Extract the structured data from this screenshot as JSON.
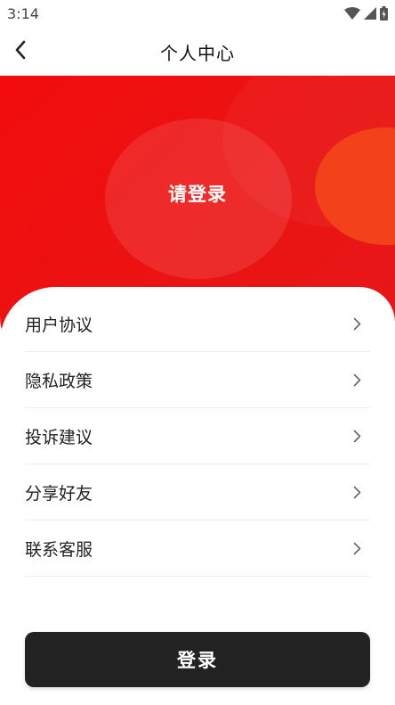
{
  "status_bar": {
    "time": "3:14",
    "icons": [
      "wifi-icon",
      "signal-icon",
      "battery-icon"
    ]
  },
  "nav": {
    "back_icon": "chevron-left-icon",
    "title": "个人中心"
  },
  "hero": {
    "login_prompt": "请登录",
    "color": "#f20c0c",
    "accent_circle_color": "#f3421a"
  },
  "menu": {
    "items": [
      {
        "label": "用户协议",
        "icon": "chevron-right-icon"
      },
      {
        "label": "隐私政策",
        "icon": "chevron-right-icon"
      },
      {
        "label": "投诉建议",
        "icon": "chevron-right-icon"
      },
      {
        "label": "分享好友",
        "icon": "chevron-right-icon"
      },
      {
        "label": "联系客服",
        "icon": "chevron-right-icon"
      }
    ]
  },
  "footer": {
    "login_button_label": "登录",
    "button_color": "#222222"
  }
}
